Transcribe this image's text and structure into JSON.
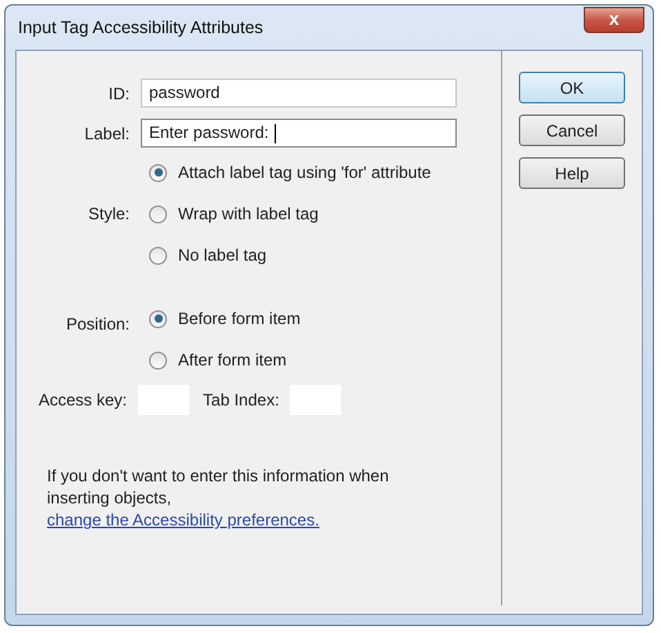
{
  "window": {
    "title": "Input Tag Accessibility Attributes",
    "close": "x"
  },
  "fields": [
    {
      "label": "ID:",
      "value": "password",
      "focused": false
    },
    {
      "label": "Label:",
      "value": "Enter password:",
      "focused": true
    }
  ],
  "groups": [
    {
      "label": "Style:",
      "options": [
        {
          "label": "Attach label tag using 'for' attribute",
          "selected": true
        },
        {
          "label": "Wrap with label tag",
          "selected": false
        },
        {
          "label": "No label tag",
          "selected": false
        }
      ]
    },
    {
      "label": "Position:",
      "options": [
        {
          "label": "Before form item",
          "selected": true
        },
        {
          "label": "After form item",
          "selected": false
        }
      ]
    }
  ],
  "small_fields": [
    {
      "label": "Access key:"
    },
    {
      "label": "Tab Index:"
    }
  ],
  "note": {
    "text": "If you don't want to enter this information when inserting objects,",
    "link": "change the Accessibility preferences."
  },
  "buttons": [
    {
      "label": "OK",
      "default": true
    },
    {
      "label": "Cancel",
      "default": false
    },
    {
      "label": "Help",
      "default": false
    }
  ]
}
